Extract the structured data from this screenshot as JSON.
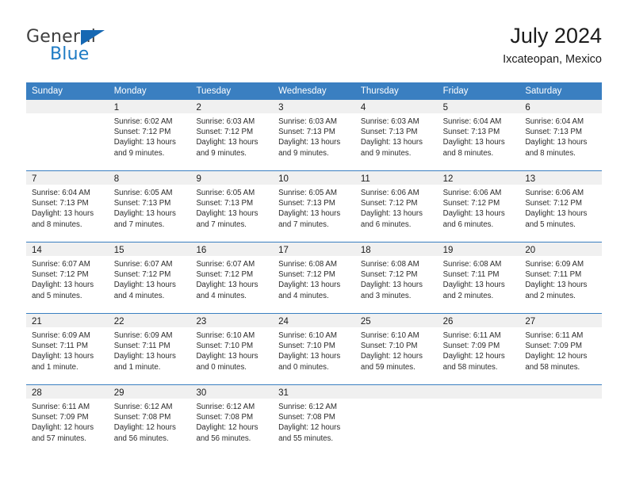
{
  "logo": {
    "word_top": "General",
    "word_bottom": "Blue",
    "triangle_icon": "triangle-icon",
    "color_dark": "#3f3f3f",
    "color_blue": "#1d7bc4"
  },
  "header": {
    "title": "July 2024",
    "subtitle": "Ixcateopan, Mexico"
  },
  "colors": {
    "header_blue": "#3a7fc1",
    "daynum_band": "#f0f0f0",
    "text": "#1b1b1b"
  },
  "weekdays": [
    "Sunday",
    "Monday",
    "Tuesday",
    "Wednesday",
    "Thursday",
    "Friday",
    "Saturday"
  ],
  "weeks": [
    [
      {
        "day": "",
        "lines": []
      },
      {
        "day": "1",
        "lines": [
          "Sunrise: 6:02 AM",
          "Sunset: 7:12 PM",
          "Daylight: 13 hours",
          "and 9 minutes."
        ]
      },
      {
        "day": "2",
        "lines": [
          "Sunrise: 6:03 AM",
          "Sunset: 7:12 PM",
          "Daylight: 13 hours",
          "and 9 minutes."
        ]
      },
      {
        "day": "3",
        "lines": [
          "Sunrise: 6:03 AM",
          "Sunset: 7:13 PM",
          "Daylight: 13 hours",
          "and 9 minutes."
        ]
      },
      {
        "day": "4",
        "lines": [
          "Sunrise: 6:03 AM",
          "Sunset: 7:13 PM",
          "Daylight: 13 hours",
          "and 9 minutes."
        ]
      },
      {
        "day": "5",
        "lines": [
          "Sunrise: 6:04 AM",
          "Sunset: 7:13 PM",
          "Daylight: 13 hours",
          "and 8 minutes."
        ]
      },
      {
        "day": "6",
        "lines": [
          "Sunrise: 6:04 AM",
          "Sunset: 7:13 PM",
          "Daylight: 13 hours",
          "and 8 minutes."
        ]
      }
    ],
    [
      {
        "day": "7",
        "lines": [
          "Sunrise: 6:04 AM",
          "Sunset: 7:13 PM",
          "Daylight: 13 hours",
          "and 8 minutes."
        ]
      },
      {
        "day": "8",
        "lines": [
          "Sunrise: 6:05 AM",
          "Sunset: 7:13 PM",
          "Daylight: 13 hours",
          "and 7 minutes."
        ]
      },
      {
        "day": "9",
        "lines": [
          "Sunrise: 6:05 AM",
          "Sunset: 7:13 PM",
          "Daylight: 13 hours",
          "and 7 minutes."
        ]
      },
      {
        "day": "10",
        "lines": [
          "Sunrise: 6:05 AM",
          "Sunset: 7:13 PM",
          "Daylight: 13 hours",
          "and 7 minutes."
        ]
      },
      {
        "day": "11",
        "lines": [
          "Sunrise: 6:06 AM",
          "Sunset: 7:12 PM",
          "Daylight: 13 hours",
          "and 6 minutes."
        ]
      },
      {
        "day": "12",
        "lines": [
          "Sunrise: 6:06 AM",
          "Sunset: 7:12 PM",
          "Daylight: 13 hours",
          "and 6 minutes."
        ]
      },
      {
        "day": "13",
        "lines": [
          "Sunrise: 6:06 AM",
          "Sunset: 7:12 PM",
          "Daylight: 13 hours",
          "and 5 minutes."
        ]
      }
    ],
    [
      {
        "day": "14",
        "lines": [
          "Sunrise: 6:07 AM",
          "Sunset: 7:12 PM",
          "Daylight: 13 hours",
          "and 5 minutes."
        ]
      },
      {
        "day": "15",
        "lines": [
          "Sunrise: 6:07 AM",
          "Sunset: 7:12 PM",
          "Daylight: 13 hours",
          "and 4 minutes."
        ]
      },
      {
        "day": "16",
        "lines": [
          "Sunrise: 6:07 AM",
          "Sunset: 7:12 PM",
          "Daylight: 13 hours",
          "and 4 minutes."
        ]
      },
      {
        "day": "17",
        "lines": [
          "Sunrise: 6:08 AM",
          "Sunset: 7:12 PM",
          "Daylight: 13 hours",
          "and 4 minutes."
        ]
      },
      {
        "day": "18",
        "lines": [
          "Sunrise: 6:08 AM",
          "Sunset: 7:12 PM",
          "Daylight: 13 hours",
          "and 3 minutes."
        ]
      },
      {
        "day": "19",
        "lines": [
          "Sunrise: 6:08 AM",
          "Sunset: 7:11 PM",
          "Daylight: 13 hours",
          "and 2 minutes."
        ]
      },
      {
        "day": "20",
        "lines": [
          "Sunrise: 6:09 AM",
          "Sunset: 7:11 PM",
          "Daylight: 13 hours",
          "and 2 minutes."
        ]
      }
    ],
    [
      {
        "day": "21",
        "lines": [
          "Sunrise: 6:09 AM",
          "Sunset: 7:11 PM",
          "Daylight: 13 hours",
          "and 1 minute."
        ]
      },
      {
        "day": "22",
        "lines": [
          "Sunrise: 6:09 AM",
          "Sunset: 7:11 PM",
          "Daylight: 13 hours",
          "and 1 minute."
        ]
      },
      {
        "day": "23",
        "lines": [
          "Sunrise: 6:10 AM",
          "Sunset: 7:10 PM",
          "Daylight: 13 hours",
          "and 0 minutes."
        ]
      },
      {
        "day": "24",
        "lines": [
          "Sunrise: 6:10 AM",
          "Sunset: 7:10 PM",
          "Daylight: 13 hours",
          "and 0 minutes."
        ]
      },
      {
        "day": "25",
        "lines": [
          "Sunrise: 6:10 AM",
          "Sunset: 7:10 PM",
          "Daylight: 12 hours",
          "and 59 minutes."
        ]
      },
      {
        "day": "26",
        "lines": [
          "Sunrise: 6:11 AM",
          "Sunset: 7:09 PM",
          "Daylight: 12 hours",
          "and 58 minutes."
        ]
      },
      {
        "day": "27",
        "lines": [
          "Sunrise: 6:11 AM",
          "Sunset: 7:09 PM",
          "Daylight: 12 hours",
          "and 58 minutes."
        ]
      }
    ],
    [
      {
        "day": "28",
        "lines": [
          "Sunrise: 6:11 AM",
          "Sunset: 7:09 PM",
          "Daylight: 12 hours",
          "and 57 minutes."
        ]
      },
      {
        "day": "29",
        "lines": [
          "Sunrise: 6:12 AM",
          "Sunset: 7:08 PM",
          "Daylight: 12 hours",
          "and 56 minutes."
        ]
      },
      {
        "day": "30",
        "lines": [
          "Sunrise: 6:12 AM",
          "Sunset: 7:08 PM",
          "Daylight: 12 hours",
          "and 56 minutes."
        ]
      },
      {
        "day": "31",
        "lines": [
          "Sunrise: 6:12 AM",
          "Sunset: 7:08 PM",
          "Daylight: 12 hours",
          "and 55 minutes."
        ]
      },
      {
        "day": "",
        "lines": []
      },
      {
        "day": "",
        "lines": []
      },
      {
        "day": "",
        "lines": []
      }
    ]
  ]
}
